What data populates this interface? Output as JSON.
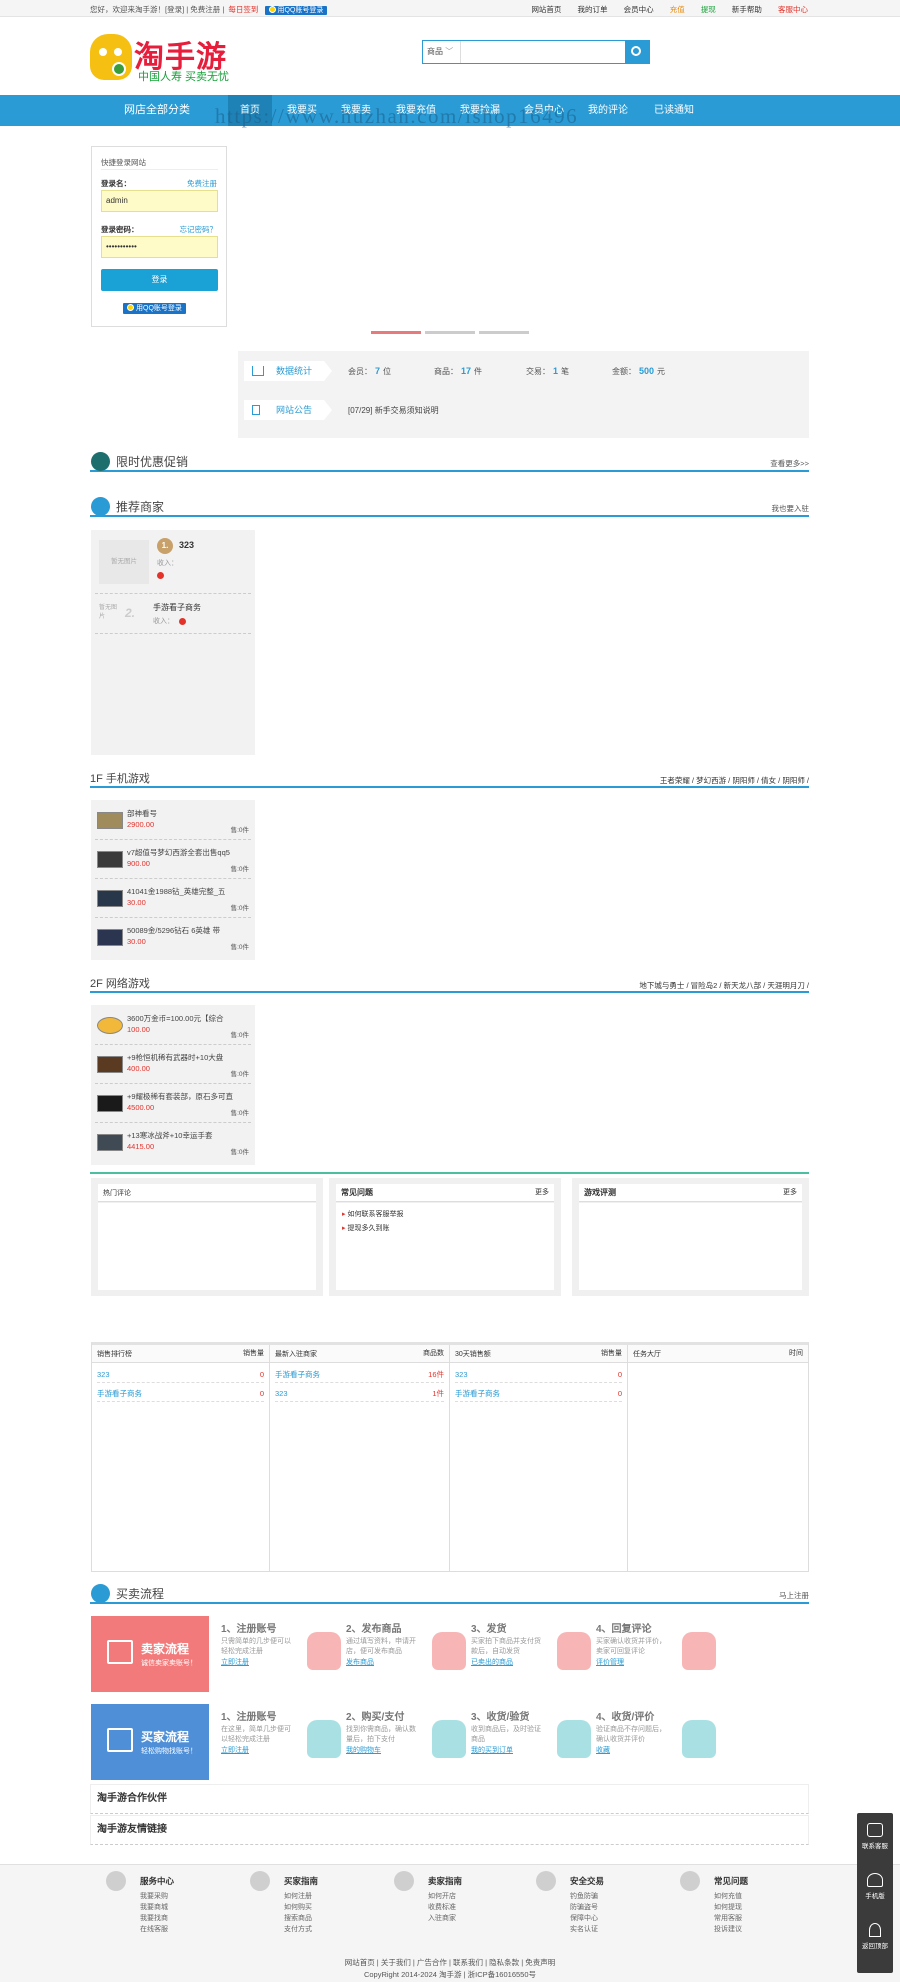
{
  "topbar": {
    "greeting": "您好，欢迎来淘手游！[登录] | 免费注册 |",
    "daily": "每日签到",
    "qq_login": "用QQ账号登录",
    "links": [
      "网站首页",
      "我的订单",
      "会员中心",
      "充值",
      "提现",
      "新手帮助",
      "客服中心"
    ]
  },
  "logo": {
    "title": "淘手游",
    "slogan": "中国人寿  买卖无忧"
  },
  "search": {
    "category": "商品",
    "placeholder": ""
  },
  "nav": {
    "all_cats": "网店全部分类",
    "items": [
      "首页",
      "我要买",
      "我要卖",
      "我要充值",
      "我要捡漏",
      "会员中心",
      "我的评论",
      "已读通知"
    ]
  },
  "watermark": "https://www.huzhan.com/ishop16496",
  "login": {
    "title": "快捷登录网站",
    "user_label": "登录名：",
    "register": "免费注册",
    "user_value": "admin",
    "pwd_label": "登录密码：",
    "forgot": "忘记密码？",
    "pwd_value": "•••••••••••",
    "submit": "登录",
    "qq": "用QQ账号登录"
  },
  "stats": {
    "label": "数据统计",
    "members_label": "会员：",
    "members": "7",
    "members_unit": "位",
    "goods_label": "商品：",
    "goods": "17",
    "goods_unit": "件",
    "trades_label": "交易：",
    "trades": "1",
    "trades_unit": "笔",
    "amount_label": "金额：",
    "amount": "500",
    "amount_unit": "元",
    "notice_label": "网站公告",
    "notice": "[07/29] 新手交易须知说明"
  },
  "promo": {
    "title": "限时优惠促销",
    "more": "查看更多>>"
  },
  "merchants": {
    "title": "推荐商家",
    "more": "我也要入驻",
    "list": [
      {
        "rank": "1.",
        "name": "323",
        "sub": "收入：",
        "noimg": "暂无图片"
      },
      {
        "rank": "2.",
        "name": "手游看子商务",
        "sub": "收入：",
        "noimg": "暂无图片"
      }
    ]
  },
  "floor1": {
    "title": "1F 手机游戏",
    "links": "王者荣耀 / 梦幻西游 / 阴阳师 / 倩女 / 阴阳师 /",
    "items": [
      {
        "name": "部神看号",
        "price": "2900.00",
        "stock": "售:0件"
      },
      {
        "name": "v7超值号梦幻西游全套出售qq5",
        "price": "900.00",
        "stock": "售:0件"
      },
      {
        "name": "41041金1988钻_英雄完整_五",
        "price": "30.00",
        "stock": "售:0件"
      },
      {
        "name": "50089金/5296钻石 6英雄 带",
        "price": "30.00",
        "stock": "售:0件"
      }
    ]
  },
  "floor2": {
    "title": "2F 网络游戏",
    "links": "地下城与勇士 / 冒险岛2 / 新天龙八部 / 天涯明月刀 /",
    "items": [
      {
        "name": "3600万金币=100.00元【综合",
        "price": "100.00",
        "stock": "售:0件"
      },
      {
        "name": "+9枪恒机稀有武器时+10大盘",
        "price": "400.00",
        "stock": "售:0件"
      },
      {
        "name": "+9耀极稀有套装部，原石多可直",
        "price": "4500.00",
        "stock": "售:0件"
      },
      {
        "name": "+13寒冰战斧+10幸运手套",
        "price": "4415.00",
        "stock": "售:0件"
      }
    ]
  },
  "boxes": [
    {
      "title": "热门评论",
      "more": ""
    },
    {
      "title": "常见问题",
      "more": "更多",
      "items": [
        "如何联系客服举报",
        "提现多久到账"
      ]
    },
    {
      "title": "游戏评测",
      "more": "更多"
    }
  ],
  "ranks": [
    {
      "title": "销售排行榜",
      "col": "销售量",
      "rows": [
        {
          "n": "323",
          "v": "0"
        },
        {
          "n": "手游看子商务",
          "v": "0"
        }
      ]
    },
    {
      "title": "最新入驻商家",
      "col": "商品数",
      "rows": [
        {
          "n": "手游看子商务",
          "v": "16件"
        },
        {
          "n": "323",
          "v": "1件"
        }
      ]
    },
    {
      "title": "30天销售额",
      "col": "销售量",
      "rows": [
        {
          "n": "323",
          "v": "0"
        },
        {
          "n": "手游看子商务",
          "v": "0"
        }
      ]
    },
    {
      "title": "任务大厅",
      "col": "时间",
      "rows": []
    }
  ],
  "flow": {
    "title": "买卖流程",
    "more": "马上注册",
    "seller": {
      "t": "卖家流程",
      "s": "诚信卖家卖账号！",
      "steps": [
        {
          "t": "1、注册账号",
          "d": "只需简单的几步便可以轻松完成注册",
          "l": "立即注册"
        },
        {
          "t": "2、发布商品",
          "d": "通过填写资料，申请开店，便可发布商品",
          "l": "发布商品"
        },
        {
          "t": "3、发货",
          "d": "买家拍下商品并支付货款后，自动发货",
          "l": "已卖出的商品"
        },
        {
          "t": "4、回复评论",
          "d": "买家确认收货并评价，卖家可回复评论",
          "l": "评价管理"
        }
      ]
    },
    "buyer": {
      "t": "买家流程",
      "s": "轻松购物找账号！",
      "steps": [
        {
          "t": "1、注册账号",
          "d": "在这里，简单几步便可以轻松完成注册",
          "l": "立即注册"
        },
        {
          "t": "2、购买/支付",
          "d": "找到你需商品，确认数量后，拍下支付",
          "l": "我的购物车"
        },
        {
          "t": "3、收货/验货",
          "d": "收到商品后，及时验证商品",
          "l": "我的买到订单"
        },
        {
          "t": "4、收货/评价",
          "d": "验证商品不存问题后，确认收货并评价",
          "l": "收藏"
        }
      ]
    }
  },
  "partners": [
    "淘手游合作伙伴",
    "淘手游友情链接"
  ],
  "footer": {
    "cols": [
      {
        "h": "服务中心",
        "x": [
          "我要采购",
          "我要商城",
          "我要找商",
          "在线客服"
        ]
      },
      {
        "h": "买家指南",
        "x": [
          "如何注册",
          "如何购买",
          "搜索商品",
          "支付方式"
        ]
      },
      {
        "h": "卖家指南",
        "x": [
          "如何开店",
          "收费标准",
          "入驻商家"
        ]
      },
      {
        "h": "安全交易",
        "x": [
          "钓鱼防骗",
          "防骗盗号",
          "保障中心",
          "实名认证"
        ]
      },
      {
        "h": "常见问题",
        "x": [
          "如何充值",
          "如何提现",
          "常用客服",
          "投诉建议"
        ]
      }
    ],
    "links": "网站首页 | 关于我们 | 广告合作 | 联系我们 | 隐私条款 | 免责声明",
    "copy": "CopyRight 2014-2024 淘手游 | 浙ICP备16016550号"
  },
  "side": [
    "联系客服",
    "手机版",
    "返回顶部"
  ]
}
